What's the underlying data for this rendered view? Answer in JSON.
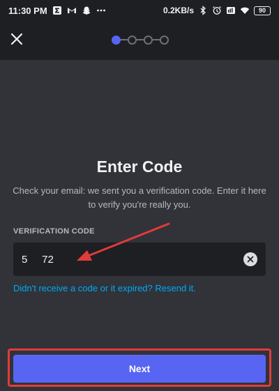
{
  "status_bar": {
    "time": "11:30 PM",
    "net_speed": "0.2KB/s",
    "battery": "90",
    "left_icons": [
      "sigma-icon",
      "gmail-icon",
      "snapchat-icon",
      "more-dots-icon"
    ],
    "right_icons": [
      "bluetooth-icon",
      "alarm-icon",
      "volte-icon",
      "wifi-icon"
    ]
  },
  "header": {
    "steps_total": 4,
    "current_step": 1,
    "close_icon": "close-icon"
  },
  "main": {
    "title": "Enter Code",
    "subtitle": "Check your email: we sent you a verification code. Enter it here to verify you're really you.",
    "field_label": "VERIFICATION CODE",
    "code_value": "5     72",
    "resend_text": "Didn't receive a code or it expired? Resend it."
  },
  "footer": {
    "next_label": "Next"
  },
  "colors": {
    "background": "#313338",
    "header": "#1e1f22",
    "accent": "#5865f2",
    "link": "#00a8fc",
    "annotation": "#e23b3b"
  }
}
